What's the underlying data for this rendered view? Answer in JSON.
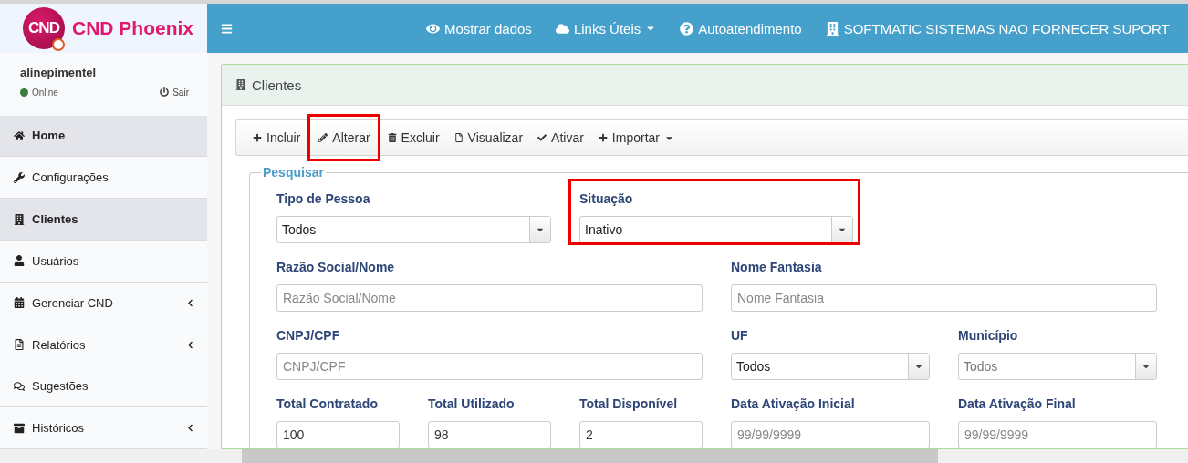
{
  "logo": {
    "badge": "CND",
    "name": "CND Phoenix"
  },
  "user": {
    "name": "alinepimentel",
    "status": "Online",
    "online": true,
    "logout": "Sair"
  },
  "sidebar": {
    "items": [
      {
        "label": "Home",
        "selected": true,
        "expandable": false
      },
      {
        "label": "Configurações",
        "selected": false,
        "expandable": false
      },
      {
        "label": "Clientes",
        "selected": true,
        "expandable": false
      },
      {
        "label": "Usuários",
        "selected": false,
        "expandable": false
      },
      {
        "label": "Gerenciar CND",
        "selected": false,
        "expandable": true
      },
      {
        "label": "Relatórios",
        "selected": false,
        "expandable": true
      },
      {
        "label": "Sugestões",
        "selected": false,
        "expandable": false
      },
      {
        "label": "Históricos",
        "selected": false,
        "expandable": true
      }
    ]
  },
  "topbar": {
    "items": [
      {
        "label": "Mostrar dados",
        "dropdown": false
      },
      {
        "label": "Links Úteis",
        "dropdown": true
      },
      {
        "label": "Autoatendimento",
        "dropdown": false
      },
      {
        "label": "SOFTMATIC SISTEMAS NAO FORNECER SUPORT",
        "dropdown": false
      }
    ]
  },
  "panel": {
    "title": "Clientes"
  },
  "toolbar": {
    "items": [
      {
        "label": "Incluir",
        "dropdown": false,
        "highlighted": false
      },
      {
        "label": "Alterar",
        "dropdown": false,
        "highlighted": true
      },
      {
        "label": "Excluir",
        "dropdown": false,
        "highlighted": false
      },
      {
        "label": "Visualizar",
        "dropdown": false,
        "highlighted": false
      },
      {
        "label": "Ativar",
        "dropdown": false,
        "highlighted": false
      },
      {
        "label": "Importar",
        "dropdown": true,
        "highlighted": false
      }
    ]
  },
  "search": {
    "legend": "Pesquisar",
    "fields": [
      {
        "kind": "select",
        "label": "Tipo de Pessoa",
        "value": "Todos",
        "highlighted": false,
        "disabled": false
      },
      {
        "kind": "select",
        "label": "Situação",
        "value": "Inativo",
        "highlighted": true,
        "disabled": false
      },
      {
        "kind": "text",
        "label": "Razão Social/Nome",
        "placeholder": "Razão Social/Nome",
        "highlighted": false
      },
      {
        "kind": "text",
        "label": "Nome Fantasia",
        "placeholder": "Nome Fantasia",
        "highlighted": false
      },
      {
        "kind": "text",
        "label": "CNPJ/CPF",
        "placeholder": "CNPJ/CPF",
        "highlighted": false
      },
      {
        "kind": "select",
        "label": "UF",
        "value": "Todos",
        "highlighted": false,
        "disabled": false
      },
      {
        "kind": "select",
        "label": "Município",
        "value": "Todos",
        "highlighted": false,
        "disabled": true
      },
      {
        "kind": "text",
        "label": "Total Contratado",
        "value": "100",
        "highlighted": false
      },
      {
        "kind": "text",
        "label": "Total Utilizado",
        "value": "98",
        "highlighted": false
      },
      {
        "kind": "text",
        "label": "Total Disponível",
        "value": "2",
        "highlighted": false
      },
      {
        "kind": "text",
        "label": "Data Ativação Inicial",
        "placeholder": "99/99/9999",
        "highlighted": false
      },
      {
        "kind": "text",
        "label": "Data Ativação Final",
        "placeholder": "99/99/9999",
        "highlighted": false
      }
    ]
  }
}
